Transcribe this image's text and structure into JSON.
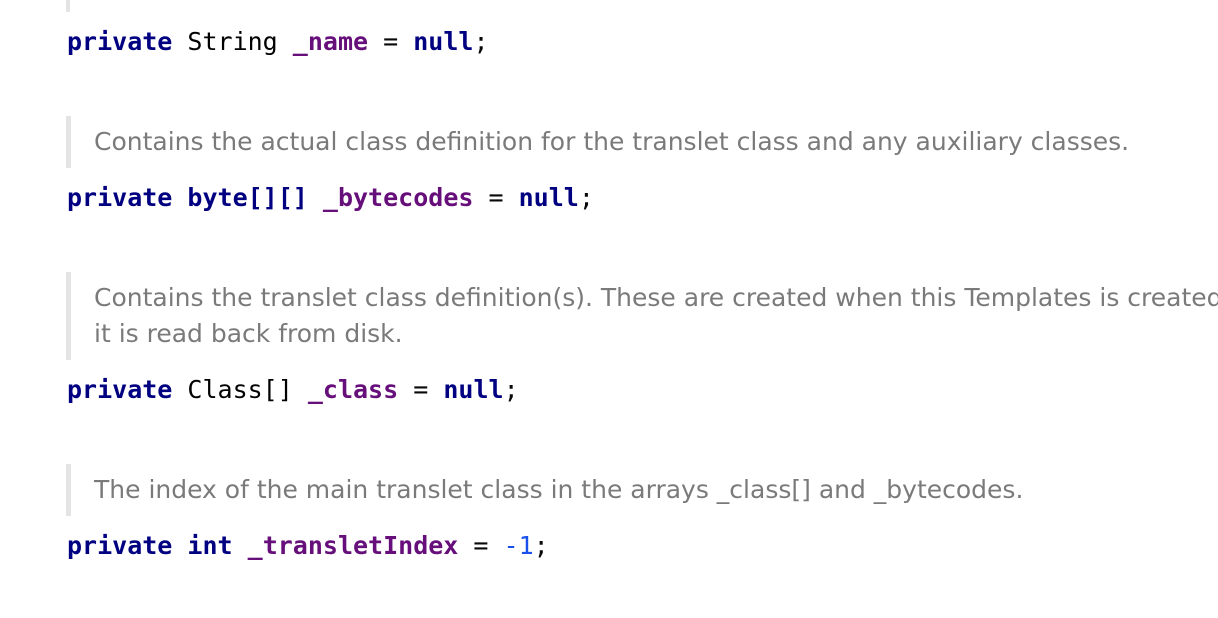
{
  "lines": [
    {
      "modifier": "private",
      "type": "String",
      "name": "_name",
      "op": "=",
      "value": "null",
      "end": ";"
    },
    {
      "doc": [
        "Contains the actual class definition for the translet class and any auxiliary classes."
      ],
      "modifier": "private",
      "type": "byte[][]",
      "name": "_bytecodes",
      "op": "=",
      "value": "null",
      "end": ";"
    },
    {
      "doc": [
        "Contains the translet class definition(s). These are created when this Templates is created",
        "it is read back from disk."
      ],
      "modifier": "private",
      "type": "Class[]",
      "name": "_class",
      "op": "=",
      "value": "null",
      "end": ";"
    },
    {
      "doc": [
        "The index of the main translet class in the arrays _class[] and _bytecodes."
      ],
      "modifier": "private",
      "type": "int",
      "name": "_transletIndex",
      "op": "=",
      "value": "-1",
      "end": ";"
    }
  ],
  "colors": {
    "keyword": "#000080",
    "field": "#660e7a",
    "number": "#1750eb",
    "doc_text": "#7a7a7a",
    "doc_bar": "#e4e4e4"
  }
}
